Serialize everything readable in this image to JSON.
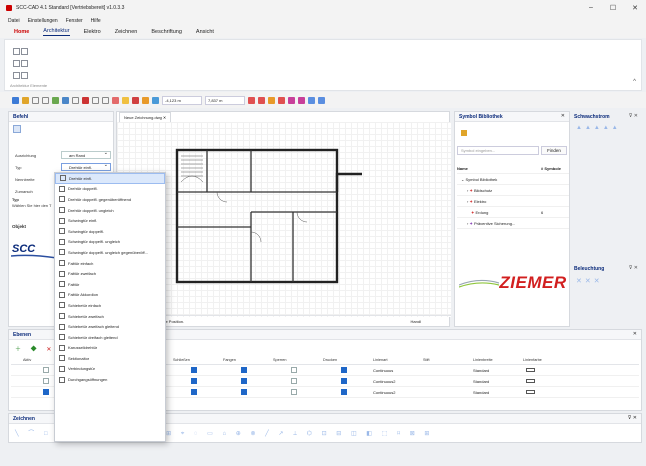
{
  "app": {
    "title": "SCC-CAD 4.1 Standard [Vertriebsbereit] v1.0.3.3",
    "win_min": "–",
    "win_max": "☐",
    "win_close": "✕"
  },
  "menu": [
    "Datei",
    "Einstellungen",
    "Fenster",
    "Hilfe"
  ],
  "ribbon": {
    "tabs": [
      "Home",
      "Architektur",
      "Elektro",
      "Zeichnen",
      "Beschriftung",
      "Ansicht"
    ],
    "active": "Architektur",
    "group_label": "Architektur Elemente",
    "collapse": "^"
  },
  "toolbar": {
    "field1": "-4,123 m",
    "field2": "7,837 m"
  },
  "befehl": {
    "title": "Befehl",
    "ausrichtung_label": "Ausrichtung",
    "ausrichtung_value": "am Rand",
    "typ_label": "Typ",
    "typ_value": "Drehtür einfl.",
    "breite_label": "Nennbreite",
    "zumarsch_label": "Zumarsch",
    "typ_head": "Typ",
    "hint": "Wählen Sie hier den T",
    "objekt_label": "Objekt"
  },
  "dropdown": [
    "Drehtür einfl.",
    "Drehtür doppelfl.",
    "Drehtür doppelfl. gegenüberöffnend",
    "Drehtür doppelfl. ungleich",
    "Schwingtür einfl.",
    "Schwingtür doppelfl.",
    "Schwingtür doppelfl. ungleich",
    "Schwingtür doppelfl. ungleich gegenüberöff...",
    "Falttür einfach",
    "Falttür zweifach",
    "Falttür",
    "Falttür Akkordion",
    "Schiebetür einfach",
    "Schiebetür zweifach",
    "Schiebetür zweifach gleitend",
    "Schiebetür dreifach gleitend",
    "Karusselldrehtür",
    "Sektionaltor",
    "Verbindungstür",
    "Durchgangsöffnungen"
  ],
  "drawing": {
    "tab": "Neue Zeichnung.dwg",
    "status": "e die Position.",
    "status_right": "Handl"
  },
  "symlib": {
    "title": "Symbol Bibliothek",
    "search_placeholder": "Symbol eingeben...",
    "find_btn": "Finden",
    "col_name": "Name",
    "col_count": "# Symbole",
    "items": [
      {
        "name": "Symbol Bibliothek",
        "count": ""
      },
      {
        "name": "Bildschutz",
        "count": ""
      },
      {
        "name": "Elektro",
        "count": ""
      },
      {
        "name": "Erdung",
        "count": "6"
      },
      {
        "name": "Präventive Sicherung...",
        "count": ""
      }
    ],
    "logo_text": "ZIEMER"
  },
  "right": {
    "schwachstrom": "Schwachstrom",
    "beleuchtung": "Beleuchtung"
  },
  "ebenen": {
    "title": "Ebenen",
    "col_aktiv": "Aktiv",
    "cols": [
      "Schließen",
      "Fangen",
      "Sperren",
      "Drucken",
      "Linienart",
      "Stift",
      "Linienbreite",
      "Linienfarbe"
    ],
    "rows": [
      {
        "linienart": "Continuous",
        "linienbreite": "Standard"
      },
      {
        "linienart": "Continuous2",
        "linienbreite": "Standard"
      },
      {
        "linienart": "Continuous2",
        "linienbreite": "Standard"
      }
    ]
  },
  "zeichnen": {
    "title": "Zeichnen"
  },
  "colors": {
    "accent": "#1f67c8",
    "brand_red": "#d21f1f",
    "nav": "#0a2a7a"
  }
}
